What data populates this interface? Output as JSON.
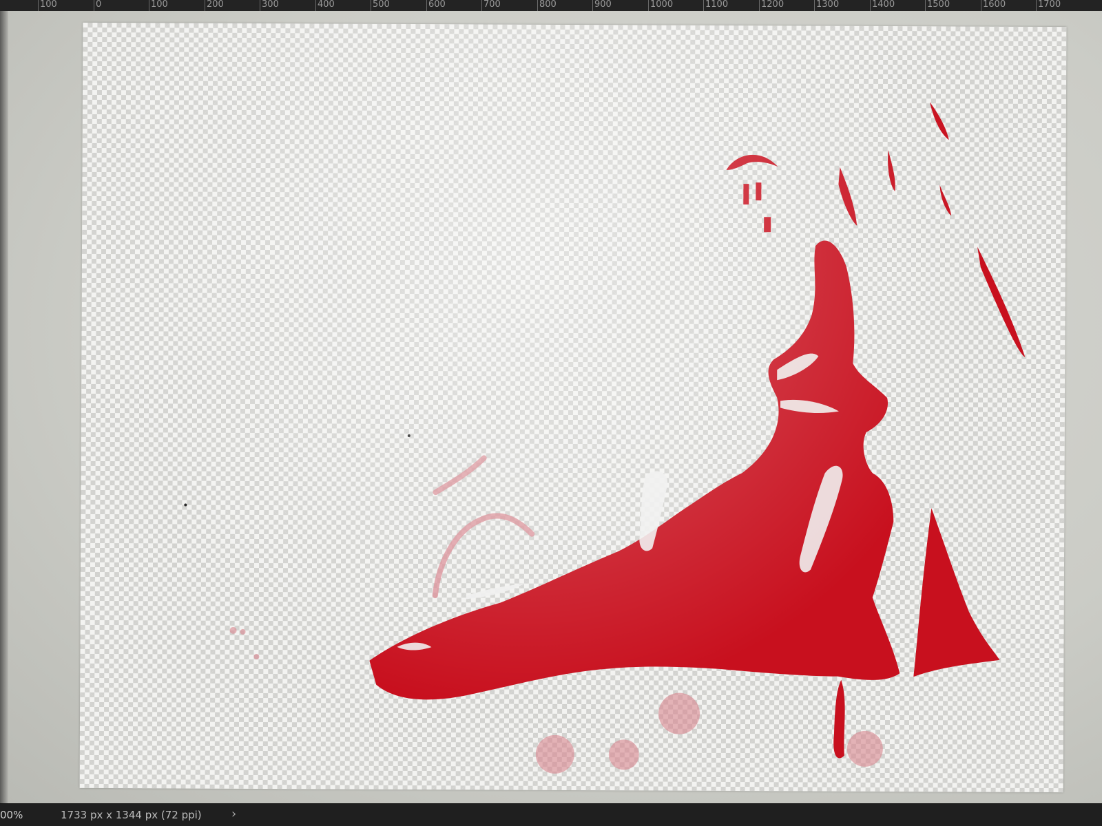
{
  "ruler": {
    "labels": [
      "100",
      "0",
      "100",
      "200",
      "300",
      "400",
      "500",
      "600",
      "700",
      "800",
      "900",
      "1000",
      "1100",
      "1200",
      "1300",
      "1400",
      "1500",
      "1600",
      "1700"
    ]
  },
  "canvas": {
    "background": "transparent-checkerboard",
    "artwork_color": "#c8101e"
  },
  "status_bar": {
    "zoom": "00%",
    "document_info": "1733 px x 1344 px (72 ppi)",
    "more_icon": "chevron-right-icon",
    "more_glyph": "›"
  }
}
